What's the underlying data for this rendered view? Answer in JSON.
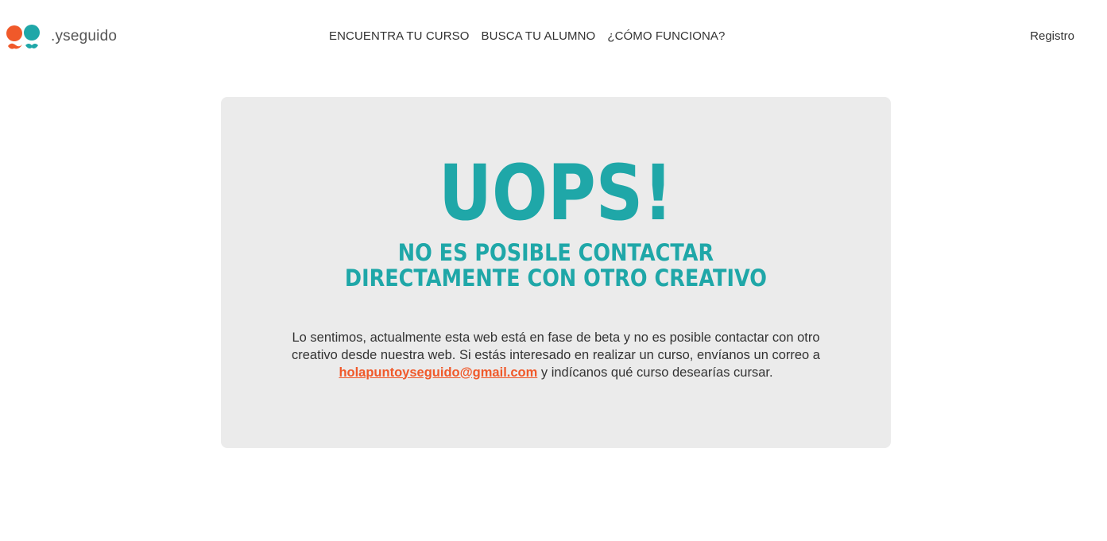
{
  "brand": {
    "name": ".yseguido",
    "colors": {
      "orange": "#f0592a",
      "teal": "#1fa7a8"
    },
    "icon": "two-heads-mustache-logo-icon"
  },
  "nav": {
    "items": [
      {
        "label": "ENCUENTRA TU CURSO"
      },
      {
        "label": "BUSCA TU ALUMNO"
      },
      {
        "label": "¿CÓMO FUNCIONA?"
      }
    ],
    "register_label": "Registro"
  },
  "error": {
    "headline": "UOPS!",
    "subhead_line1": "NO ES POSIBLE CONTACTAR",
    "subhead_line2": "DIRECTAMENTE CON OTRO CREATIVO",
    "message_before": "Lo sentimos, actualmente esta web está en fase de beta y no es posible contactar con otro creativo desde nuestra web. Si estás interesado en realizar un curso, envíanos un correo a ",
    "email": "holapuntoyseguido@gmail.com",
    "message_after": " y indícanos qué curso desearías cursar.",
    "card_background": "#ebebeb",
    "accent_color": "#1fa7a8",
    "link_color": "#f0592a"
  }
}
